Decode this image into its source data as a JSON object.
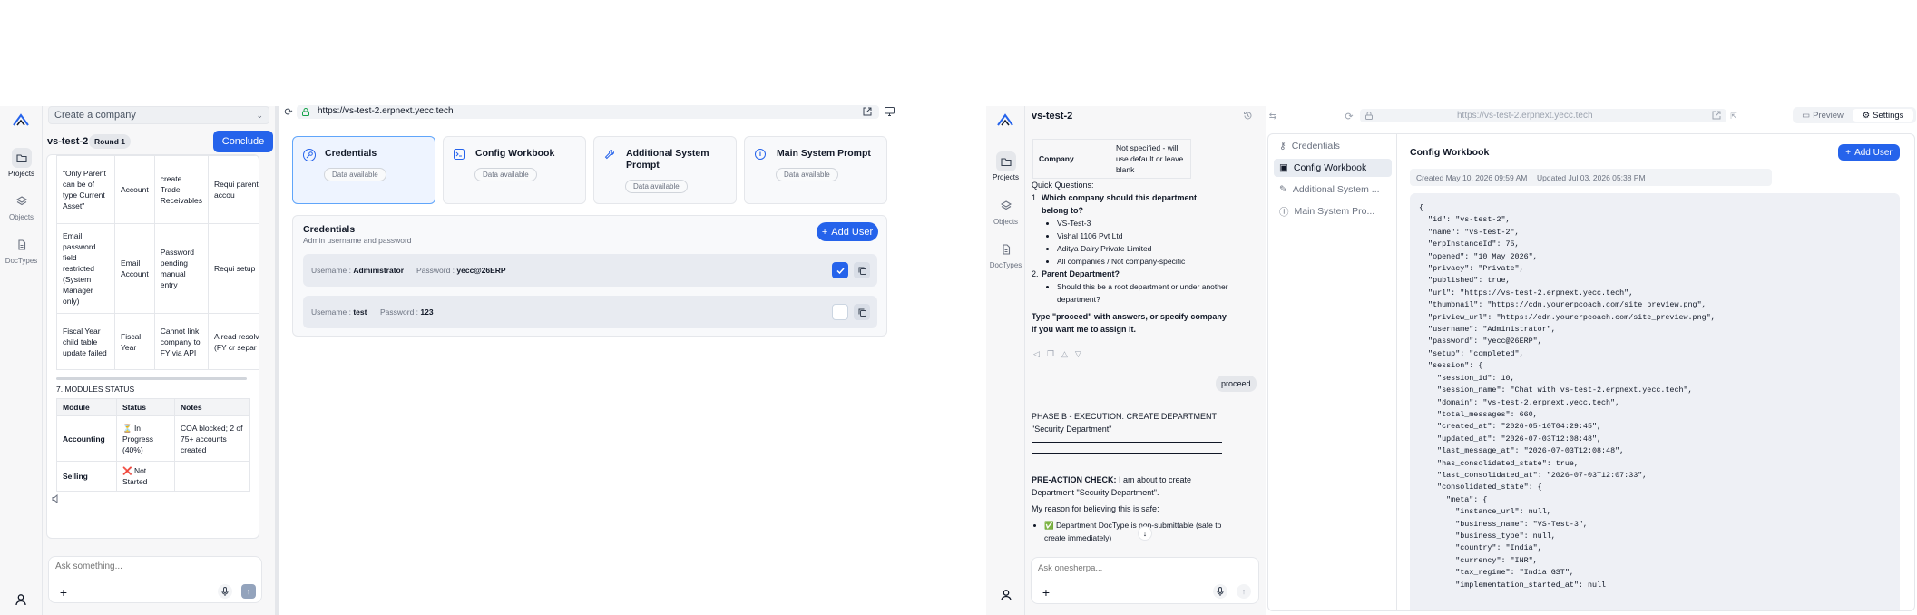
{
  "colors": {
    "accent": "#2563eb",
    "panel": "#f7f7f8"
  },
  "left": {
    "rail": [
      {
        "label": "Projects",
        "icon": "folder-icon",
        "active": true
      },
      {
        "label": "Objects",
        "icon": "layers-icon",
        "active": false
      },
      {
        "label": "DocTypes",
        "icon": "file-icon",
        "active": false
      }
    ],
    "company_select": "Create a company",
    "project_name": "vs-test-2",
    "round_badge": "Round 1",
    "conclude_label": "Conclude",
    "issues_rows": [
      {
        "c1": "\"Only Parent can be of type Current Asset\"",
        "c2": "Account",
        "c3": "create Trade Receivables",
        "c4": "Requi parent accou"
      },
      {
        "c1": "Email password field restricted (System Manager only)",
        "c2": "Email Account",
        "c3": "Password pending manual entry",
        "c4": "Requi setup"
      },
      {
        "c1": "Fiscal Year child table update failed",
        "c2": "Fiscal Year",
        "c3": "Cannot link company to FY via API",
        "c4": "Alread resolve (FY cr separ"
      }
    ],
    "modules_heading": "7. MODULES STATUS",
    "modules_headers": [
      "Module",
      "Status",
      "Notes"
    ],
    "modules_rows": [
      {
        "module": "Accounting",
        "status": "⏳ In Progress (40%)",
        "notes": "COA blocked; 2 of 75+ accounts created"
      },
      {
        "module": "Selling",
        "status": "❌ Not Started",
        "notes": ""
      }
    ],
    "input_placeholder": "Ask something..."
  },
  "browser1": {
    "url": "https://vs-test-2.erpnext.yecc.tech",
    "tiles": [
      {
        "title": "Credentials",
        "badge": "Data available",
        "icon": "key-icon"
      },
      {
        "title": "Config Workbook",
        "badge": "Data available",
        "icon": "terminal-icon"
      },
      {
        "title": "Additional System Prompt",
        "badge": "Data available",
        "icon": "wrench-icon"
      },
      {
        "title": "Main System Prompt",
        "badge": "Data available",
        "icon": "info-icon"
      }
    ],
    "cred_title": "Credentials",
    "cred_subtitle": "Admin username and password",
    "add_user_label": "Add User",
    "users": [
      {
        "username_label": "Username :",
        "username": "Administrator",
        "password_label": "Password :",
        "password": "yecc@26ERP",
        "checked": true
      },
      {
        "username_label": "Username :",
        "username": "test",
        "password_label": "Password :",
        "password": "123",
        "checked": false
      }
    ]
  },
  "chat2": {
    "project_name": "vs-test-2",
    "table_row": {
      "key": "Company",
      "value": "Not specified - will use default or leave blank"
    },
    "quick_q": "Quick Questions:",
    "q1": "Which company should this department belong to?",
    "q1_options": [
      "VS-Test-3",
      "Vishal 1106 Pvt Ltd",
      "Aditya Dairy Private Limited",
      "All companies / Not company-specific"
    ],
    "q2": "Parent Department?",
    "q2_options": [
      "Should this be a root department or under another department?"
    ],
    "prompt_bold": "Type \"proceed\" with answers, or specify company if you want me to assign it.",
    "user_msg": "proceed",
    "phase": "PHASE B - EXECUTION: CREATE DEPARTMENT \"Security Department\"",
    "pre_bold": "PRE-ACTION CHECK:",
    "pre_rest": " I am about to create Department \"Security Department\".",
    "reason": "My reason for believing this is safe:",
    "check_item": "✅ Department DocType is non-submittable (safe to create immediately)",
    "input_placeholder": "Ask onesherpa..."
  },
  "browser2": {
    "url": "https://vs-test-2.erpnext.yecc.tech",
    "preview_label": "Preview",
    "settings_label": "Settings",
    "nav": [
      {
        "label": "Credentials",
        "icon": "key-icon",
        "active": false
      },
      {
        "label": "Config Workbook",
        "icon": "terminal-icon",
        "active": true
      },
      {
        "label": "Additional System ...",
        "icon": "wrench-icon",
        "active": false
      },
      {
        "label": "Main System Pro...",
        "icon": "info-icon",
        "active": false
      }
    ],
    "section_title": "Config Workbook",
    "add_user_label": "Add User",
    "created": "Created May 10, 2026 09:59 AM",
    "updated": "Updated Jul 03, 2026 05:38 PM",
    "json_lines": [
      "{",
      "  \"id\": \"vs-test-2\",",
      "  \"name\": \"vs-test-2\",",
      "  \"erpInstanceId\": 75,",
      "  \"opened\": \"10 May 2026\",",
      "  \"privacy\": \"Private\",",
      "  \"published\": true,",
      "  \"url\": \"https://vs-test-2.erpnext.yecc.tech\",",
      "  \"thumbnail\": \"https://cdn.yourerpcoach.com/site_preview.png\",",
      "  \"priview_url\": \"https://cdn.yourerpcoach.com/site_preview.png\",",
      "  \"username\": \"Administrator\",",
      "  \"password\": \"yecc@26ERP\",",
      "  \"setup\": \"completed\",",
      "  \"session\": {",
      "    \"session_id\": 10,",
      "    \"session_name\": \"Chat with vs-test-2.erpnext.yecc.tech\",",
      "    \"domain\": \"vs-test-2.erpnext.yecc.tech\",",
      "    \"total_messages\": 660,",
      "    \"created_at\": \"2026-05-10T04:29:45\",",
      "    \"updated_at\": \"2026-07-03T12:08:48\",",
      "    \"last_message_at\": \"2026-07-03T12:08:48\",",
      "    \"has_consolidated_state\": true,",
      "    \"last_consolidated_at\": \"2026-07-03T12:07:33\",",
      "    \"consolidated_state\": {",
      "      \"meta\": {",
      "        \"instance_url\": null,",
      "        \"business_name\": \"VS-Test-3\",",
      "        \"business_type\": null,",
      "        \"country\": \"India\",",
      "        \"currency\": \"INR\",",
      "        \"tax_regime\": \"India GST\",",
      "        \"implementation_started_at\": null"
    ]
  }
}
